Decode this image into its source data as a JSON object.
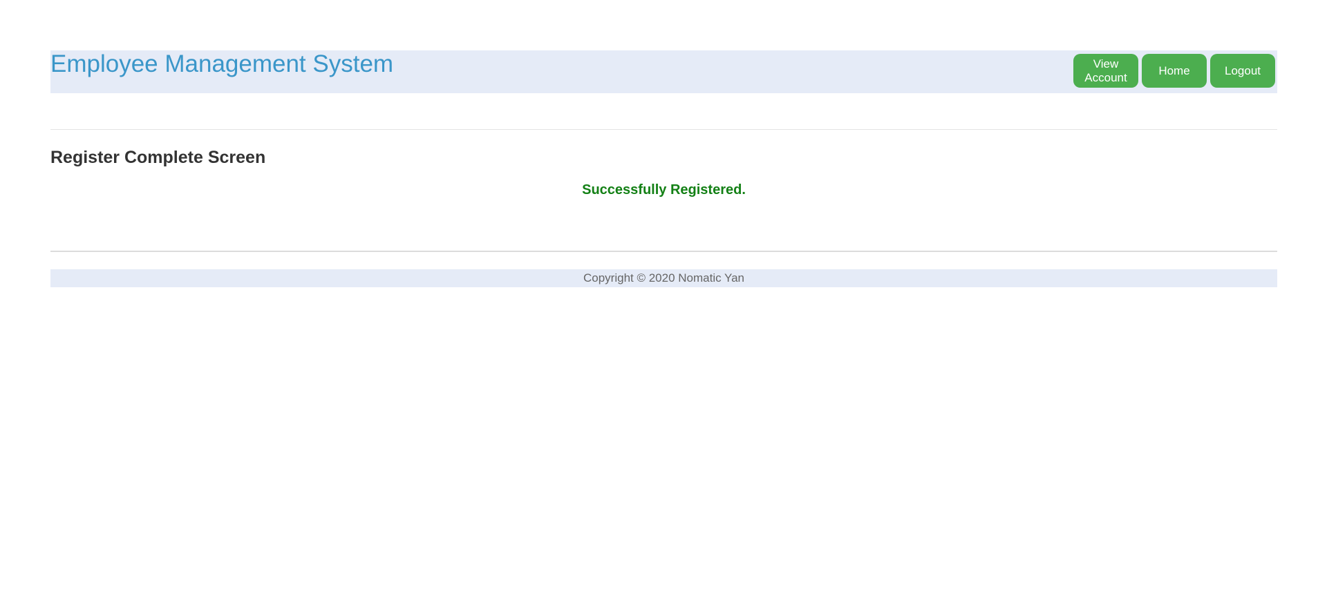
{
  "header": {
    "title": "Employee Management System",
    "nav": {
      "view_account": "View Account",
      "home": "Home",
      "logout": "Logout"
    }
  },
  "main": {
    "page_title": "Register Complete Screen",
    "message": "Successfully Registered."
  },
  "footer": {
    "copyright": "Copyright © 2020 Nomatic Yan"
  },
  "colors": {
    "header_bg": "#e5ebf7",
    "title_blue": "#3a96c9",
    "button_green": "#4cae4f",
    "success_green": "#138015"
  }
}
